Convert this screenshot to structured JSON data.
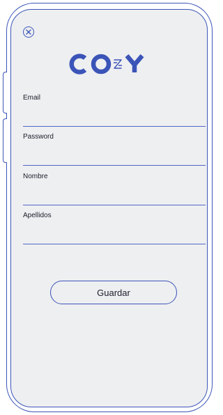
{
  "app": {
    "logo_text": "COZY",
    "brand_color": "#3b54b8",
    "screen_background": "#eeeff1"
  },
  "header": {
    "close_icon": "close-circle-icon"
  },
  "form": {
    "fields": [
      {
        "label": "Email",
        "value": "",
        "placeholder": ""
      },
      {
        "label": "Password",
        "value": "",
        "placeholder": ""
      },
      {
        "label": "Nombre",
        "value": "",
        "placeholder": ""
      },
      {
        "label": "Apellidos",
        "value": "",
        "placeholder": ""
      }
    ],
    "save_label": "Guardar"
  }
}
